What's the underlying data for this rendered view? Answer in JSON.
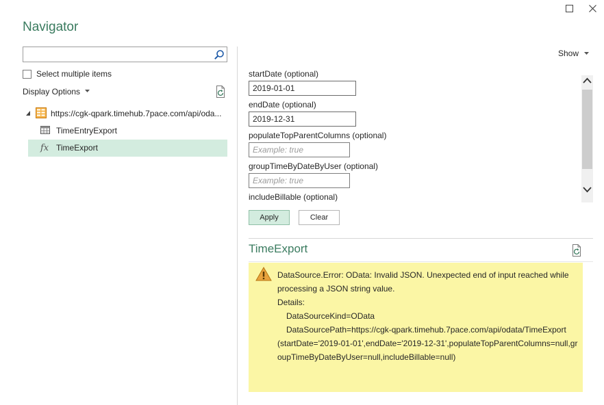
{
  "window": {
    "title": "Navigator"
  },
  "left": {
    "search": {
      "value": "",
      "placeholder": ""
    },
    "select_multiple_label": "Select multiple items",
    "display_options_label": "Display Options",
    "tree": {
      "root_label": "https://cgk-qpark.timehub.7pace.com/api/oda...",
      "children": [
        {
          "label": "TimeEntryExport",
          "icon": "table-icon",
          "selected": false
        },
        {
          "label": "TimeExport",
          "icon": "function-icon",
          "selected": true
        }
      ]
    }
  },
  "right": {
    "show_label": "Show",
    "params": [
      {
        "label": "startDate (optional)",
        "value": "2019-01-01",
        "placeholder": ""
      },
      {
        "label": "endDate (optional)",
        "value": "2019-12-31",
        "placeholder": ""
      },
      {
        "label": "populateTopParentColumns (optional)",
        "value": "",
        "placeholder": "Example: true"
      },
      {
        "label": "groupTimeByDateByUser (optional)",
        "value": "",
        "placeholder": "Example: true"
      },
      {
        "label": "includeBillable (optional)"
      }
    ],
    "apply_label": "Apply",
    "clear_label": "Clear",
    "preview_title": "TimeExport",
    "error": {
      "line1": "DataSource.Error: OData: Invalid JSON. Unexpected end of input reached while processing a JSON string value.",
      "details_label": "Details:",
      "kind": "DataSourceKind=OData",
      "path_prefix": "DataSourcePath=https://cgk-qpark.timehub.7pace.com/api/odata/TimeExport",
      "path_rest": "(startDate='2019-01-01',endDate='2019-12-31',populateTopParentColumns=null,groupTimeByDateByUser=null,includeBillable=null)"
    }
  },
  "colors": {
    "accent_green": "#3a7b5f",
    "selection": "#d3ecdf",
    "error_bg": "#fbf6a5",
    "warning": "#e8a33d"
  }
}
